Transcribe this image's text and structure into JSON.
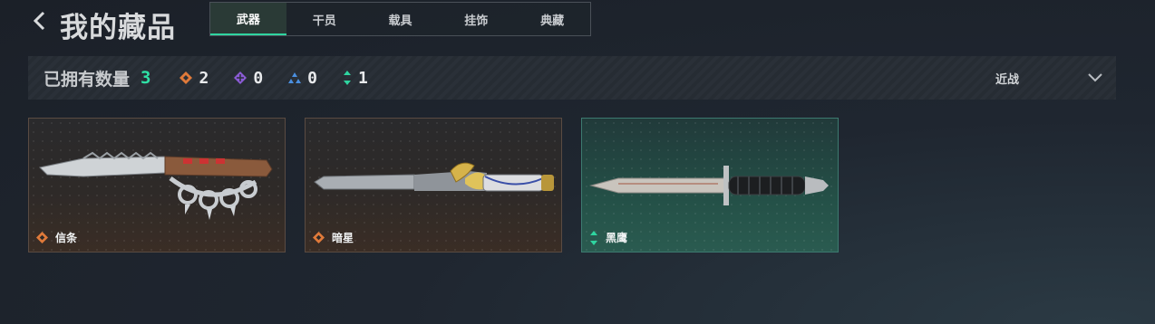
{
  "header": {
    "title": "我的藏品",
    "tabs": [
      {
        "label": "武器",
        "active": true
      },
      {
        "label": "干员",
        "active": false
      },
      {
        "label": "载具",
        "active": false
      },
      {
        "label": "挂饰",
        "active": false
      },
      {
        "label": "典藏",
        "active": false
      }
    ]
  },
  "summary": {
    "owned_label": "已拥有数量",
    "owned_count": "3",
    "rarities": [
      {
        "icon": "orange-diamond-icon",
        "color": "#e07a3a",
        "count": "2"
      },
      {
        "icon": "purple-diamond-icon",
        "color": "#8b5bd6",
        "count": "0"
      },
      {
        "icon": "blue-triangle-icon",
        "color": "#4a8fe0",
        "count": "0"
      },
      {
        "icon": "green-arrows-icon",
        "color": "#2fd5a0",
        "count": "1"
      }
    ],
    "filter_label": "近战"
  },
  "items": [
    {
      "name": "信条",
      "rarity": "orange",
      "rarity_color": "#e07a3a",
      "icon": "knuckle-knife-icon"
    },
    {
      "name": "暗星",
      "rarity": "orange",
      "rarity_color": "#e07a3a",
      "icon": "ornate-blade-icon"
    },
    {
      "name": "黑鹰",
      "rarity": "green",
      "rarity_color": "#2fd5a0",
      "icon": "dagger-icon"
    }
  ],
  "colors": {
    "accent": "#2fd5a0",
    "orange": "#e07a3a"
  }
}
